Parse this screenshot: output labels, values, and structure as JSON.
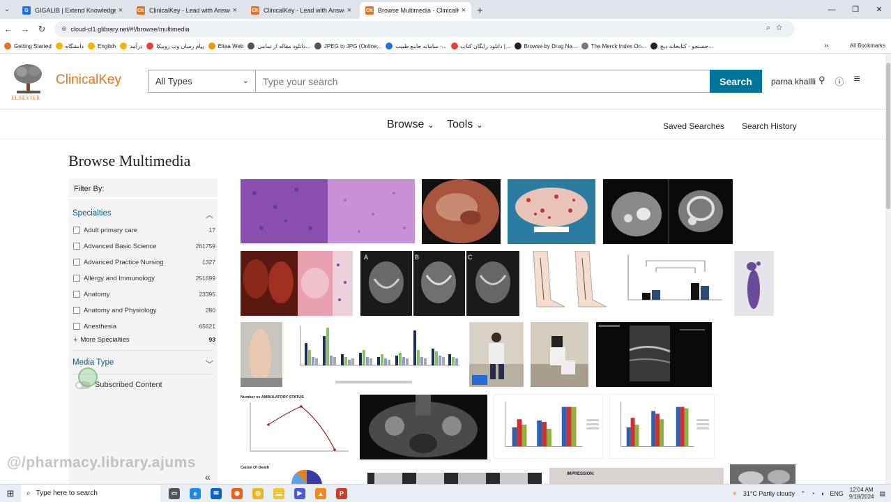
{
  "browser": {
    "tabs": [
      {
        "title": "GIGALIB | Extend Knowledge",
        "color": "#1a73e8",
        "glyph": "G",
        "active": false
      },
      {
        "title": "ClinicalKey - Lead with Answers",
        "color": "#e9711c",
        "glyph": "CK",
        "active": false
      },
      {
        "title": "ClinicalKey - Lead with Answers",
        "color": "#e9711c",
        "glyph": "CK",
        "active": false
      },
      {
        "title": "Browse Multimedia - ClinicalKe",
        "color": "#e9711c",
        "glyph": "CK",
        "active": true
      }
    ],
    "url": "cloud-cl1.glibrary.net/#!/browse/multimedia",
    "bookmarks": [
      {
        "label": "Getting Started",
        "color": "#e9711c"
      },
      {
        "label": "دانشگاه",
        "color": "#f4b400"
      },
      {
        "label": "English",
        "color": "#f4b400"
      },
      {
        "label": "درآمد",
        "color": "#f4b400"
      },
      {
        "label": "پیام رسان وب روبیکا",
        "color": "#e94235"
      },
      {
        "label": "Eitaa Web",
        "color": "#f29900"
      },
      {
        "label": "دانلود مقاله از تمامی...",
        "color": "#555"
      },
      {
        "label": "JPEG to JPG (Online...",
        "color": "#555"
      },
      {
        "label": "سامانه جامع طبیب -...",
        "color": "#1a73e8"
      },
      {
        "label": "دانلود رایگان کتاب |...",
        "color": "#e94235"
      },
      {
        "label": "Browse by Drug Na...",
        "color": "#222"
      },
      {
        "label": "The Merck Index On...",
        "color": "#777"
      },
      {
        "label": "جستجو - کتابخانه دیج...",
        "color": "#222"
      }
    ],
    "all_bookmarks": "All Bookmarks"
  },
  "header": {
    "logo_text": "ClinicalKey",
    "logo_publisher": "ELSEVIER",
    "type_select": "All Types",
    "search_placeholder": "Type your search",
    "search_button": "Search",
    "user_name": "parna khallli"
  },
  "nav": {
    "browse": "Browse",
    "tools": "Tools",
    "saved_searches": "Saved Searches",
    "search_history": "Search History"
  },
  "page": {
    "title": "Browse Multimedia"
  },
  "filter": {
    "heading": "Filter By:",
    "specialties_title": "Specialties",
    "specialties": [
      {
        "label": "Adult primary care",
        "count": "17"
      },
      {
        "label": "Advanced Basic Science",
        "count": "261759"
      },
      {
        "label": "Advanced Practice Nursing",
        "count": "1327"
      },
      {
        "label": "Allergy and Immunology",
        "count": "251699"
      },
      {
        "label": "Anatomy",
        "count": "23395"
      },
      {
        "label": "Anatomy and Physiology",
        "count": "280"
      },
      {
        "label": "Anesthesia",
        "count": "65621"
      }
    ],
    "more_specialties": "More Specialties",
    "more_count": "93",
    "media_type_title": "Media Type",
    "subscribed_label": "Subscribed Content"
  },
  "thumbnails": {
    "chart_title_1": "Number vs AMBULATORY STATUS",
    "chart_title_2": "Cause Of Death",
    "impression": "IMPRESSION:",
    "panel_labels": [
      "A",
      "B",
      "C"
    ]
  },
  "watermark": "@/pharmacy.library.ajums",
  "taskbar": {
    "search_placeholder": "Type here to search",
    "weather": "31°C  Partly cloudy",
    "lang": "ENG",
    "time": "12:04 AM",
    "date": "9/18/2024"
  }
}
